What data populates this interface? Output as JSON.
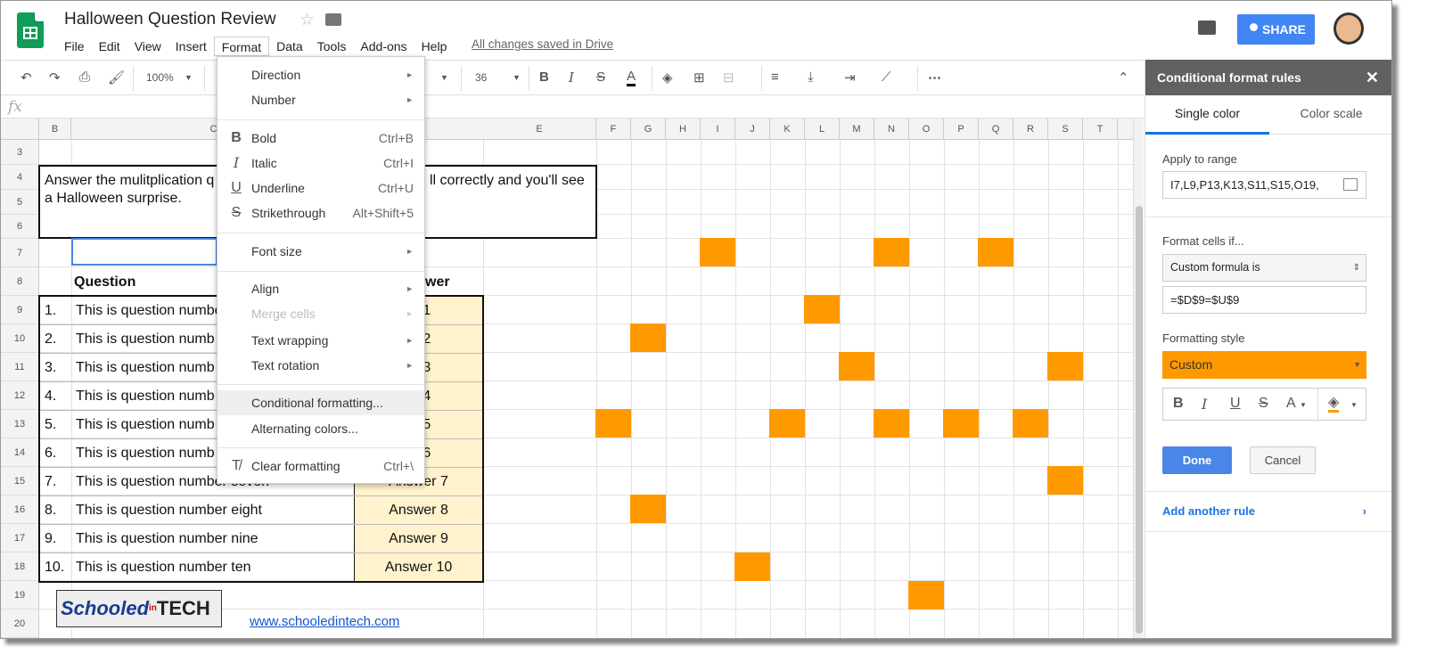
{
  "app": {
    "title": "Halloween Question Review",
    "saved": "All changes saved in Drive",
    "share": "SHARE"
  },
  "menu": [
    "File",
    "Edit",
    "View",
    "Insert",
    "Format",
    "Data",
    "Tools",
    "Add-ons",
    "Help"
  ],
  "toolbar": {
    "zoom": "100%",
    "font_size": "36",
    "bold": "B",
    "italic": "I",
    "strike": "S",
    "text_color": "A",
    "more": "⋯",
    "collapse": "⌃"
  },
  "formula_bar": {
    "fx": "fx"
  },
  "columns": [
    "B",
    "C",
    "E",
    "F",
    "G",
    "H",
    "I",
    "J",
    "K",
    "L",
    "M",
    "N",
    "O",
    "P",
    "Q",
    "R",
    "S",
    "T"
  ],
  "rows": [
    "3",
    "4",
    "5",
    "6",
    "7",
    "8",
    "9",
    "10",
    "11",
    "12",
    "13",
    "14",
    "15",
    "16",
    "17",
    "18",
    "19",
    "20"
  ],
  "sheet": {
    "instructions_line1": "Answer the mulitplication q",
    "instructions_line1b": "ll correctly and you'll see",
    "instructions_line2": "a Halloween surprise.",
    "question_header": "Question",
    "answer_header": "wer",
    "questions": [
      {
        "num": "1.",
        "text": "This is question numbe",
        "answer": "er 1"
      },
      {
        "num": "2.",
        "text": "This is question numb",
        "answer": "er 2"
      },
      {
        "num": "3.",
        "text": "This is question numb",
        "answer": "er 3"
      },
      {
        "num": "4.",
        "text": "This is question numb",
        "answer": "er 4"
      },
      {
        "num": "5.",
        "text": "This is question numb",
        "answer": "er 5"
      },
      {
        "num": "6.",
        "text": "This is question numb",
        "answer": "er 6"
      },
      {
        "num": "7.",
        "text": "This is question number seven",
        "answer": "Answer 7"
      },
      {
        "num": "8.",
        "text": "This is question number eight",
        "answer": "Answer 8"
      },
      {
        "num": "9.",
        "text": "This is question number nine",
        "answer": "Answer 9"
      },
      {
        "num": "10.",
        "text": "This is question number ten",
        "answer": "Answer 10"
      }
    ],
    "logo_text_1": "Schooled",
    "logo_text_2": "in",
    "logo_text_3": "TECH",
    "url": "www.schooledintech.com",
    "highlight_color": "#ff9900"
  },
  "format_menu": {
    "direction": "Direction",
    "number": "Number",
    "bold": "Bold",
    "bold_sc": "Ctrl+B",
    "italic": "Italic",
    "italic_sc": "Ctrl+I",
    "underline": "Underline",
    "underline_sc": "Ctrl+U",
    "strike": "Strikethrough",
    "strike_sc": "Alt+Shift+5",
    "font_size": "Font size",
    "align": "Align",
    "merge": "Merge cells",
    "wrap": "Text wrapping",
    "rotation": "Text rotation",
    "conditional": "Conditional formatting...",
    "alternating": "Alternating colors...",
    "clear": "Clear formatting",
    "clear_sc": "Ctrl+\\",
    "icon_bold": "B",
    "icon_italic": "I",
    "icon_underline": "U",
    "icon_strike": "S",
    "icon_clear": "T̸"
  },
  "sidebar": {
    "title": "Conditional format rules",
    "close": "✕",
    "tab_single": "Single color",
    "tab_scale": "Color scale",
    "apply_label": "Apply to range",
    "range_value": "I7,L9,P13,K13,S11,S15,O19,",
    "format_if_label": "Format cells if...",
    "condition": "Custom formula is",
    "formula": "=$D$9=$U$9",
    "style_label": "Formatting style",
    "style_value": "Custom",
    "done": "Done",
    "cancel": "Cancel",
    "add_rule": "Add another rule",
    "accent": "#ff9900"
  }
}
